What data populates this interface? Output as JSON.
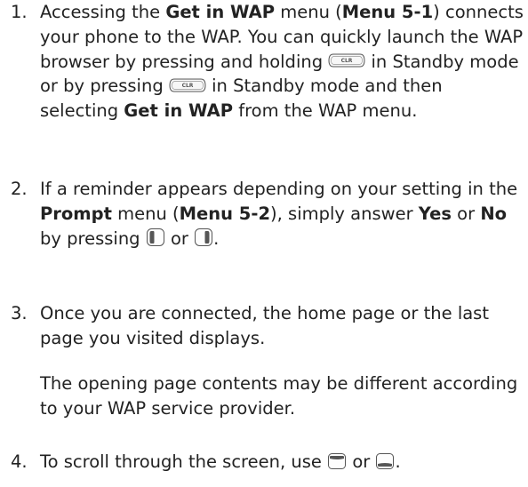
{
  "items": [
    {
      "number": "1.",
      "t1": "Accessing the ",
      "b1": "Get in WAP",
      "t2": " menu (",
      "b2": "Menu 5-1",
      "t3": ") connects your phone to the WAP. You can quickly launch the WAP browser by pressing and holding ",
      "t4": " in Standby mode or by pressing ",
      "t5": " in Standby mode and then selecting ",
      "b3": "Get in WAP",
      "t6": " from the WAP menu."
    },
    {
      "number": "2.",
      "t1": "If a reminder appears depending on your setting in the ",
      "b1": "Prompt",
      "t2": " menu (",
      "b2": "Menu 5-2",
      "t3": "), simply answer ",
      "b3": "Yes",
      "t4": " or ",
      "b4": "No",
      "t5": " by pressing ",
      "t6": " or ",
      "t7": "."
    },
    {
      "number": "3.",
      "text": "Once you are connected, the home page or the last page you visited displays.",
      "note": "The opening page contents may be different according to your WAP service provider."
    },
    {
      "number": "4.",
      "t1": "To scroll through the screen, use ",
      "t2": " or ",
      "t3": "."
    }
  ],
  "keys": {
    "clr_label": "CLR"
  },
  "icons": {
    "clr_key": "clr-key-icon",
    "left_soft_key": "left-soft-key-icon",
    "right_soft_key": "right-soft-key-icon",
    "up_key": "up-navigation-key-icon",
    "down_key": "down-navigation-key-icon"
  }
}
